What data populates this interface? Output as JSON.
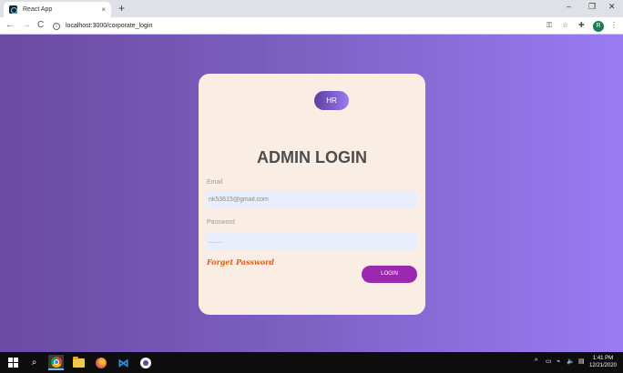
{
  "browser": {
    "tab_title": "React App",
    "tab_close": "×",
    "new_tab": "+",
    "window_controls": [
      "–",
      "❐",
      "✕"
    ],
    "back": "←",
    "forward": "→",
    "reload": "C",
    "url": "localhost:3000/corporate_login",
    "profile_initial": "R"
  },
  "card": {
    "hr_label": "HR",
    "heading": "ADMIN LOGIN",
    "email_label": "Email",
    "email_value": "nk53615@gmail.com",
    "password_label": "Password",
    "password_value": "........",
    "forgot_label": "Forget Password",
    "login_label": "LOGIN"
  },
  "taskbar": {
    "search_glyph": "⌕",
    "vscode_glyph": "⋈",
    "tray": [
      "^",
      "▭",
      "⌁",
      "🔈",
      "▤"
    ],
    "time": "1:41 PM",
    "date": "12/21/2020"
  },
  "colors": {
    "page_gradient_start": "#6a4aa2",
    "page_gradient_end": "#9a7bf3",
    "card_bg": "#faeee4",
    "login_button": "#9c27b0",
    "forgot_link": "#e35a1e"
  }
}
